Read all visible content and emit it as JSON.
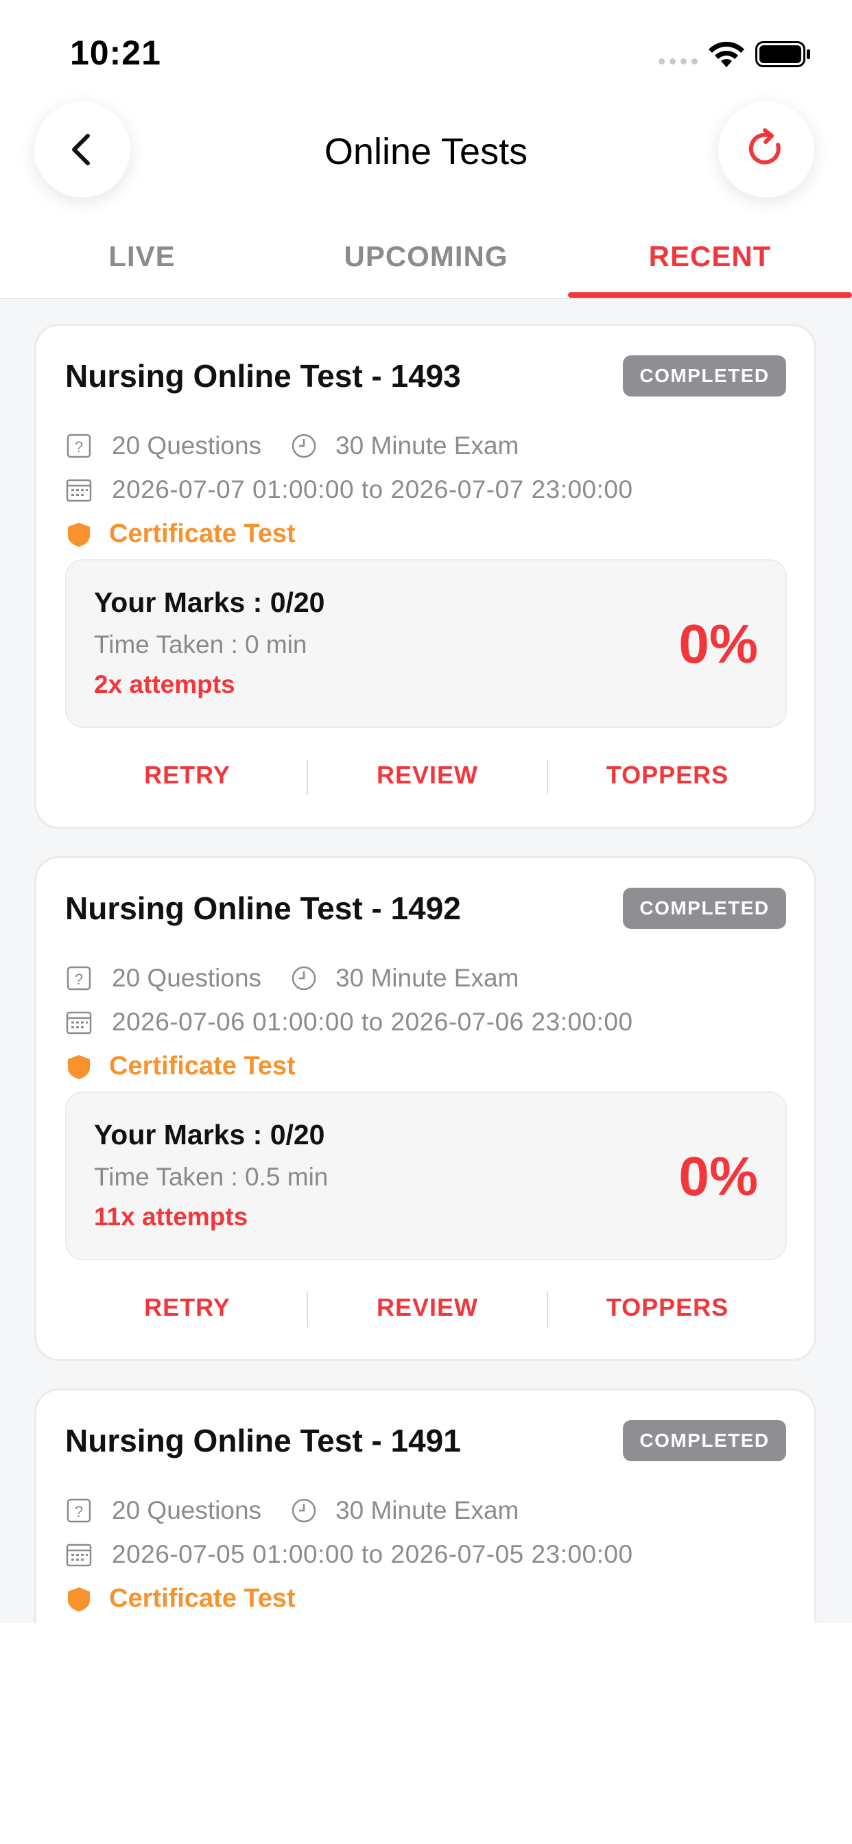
{
  "status_bar": {
    "time": "10:21"
  },
  "header": {
    "title": "Online Tests"
  },
  "tabs": [
    {
      "label": "LIVE"
    },
    {
      "label": "UPCOMING"
    },
    {
      "label": "RECENT"
    }
  ],
  "colors": {
    "accent": "#f2363b",
    "certificate": "#f7922d",
    "badge": "#8e8e93"
  },
  "tests": [
    {
      "title": "Nursing Online Test - 1493",
      "status": "COMPLETED",
      "questions": "20 Questions",
      "duration": "30 Minute Exam",
      "date_range": "2026-07-07 01:00:00 to 2026-07-07 23:00:00",
      "certificate": "Certificate Test",
      "marks": "Your Marks : 0/20",
      "time_taken": "Time Taken : 0 min",
      "attempts": "2x attempts",
      "percent": "0%",
      "actions": [
        "RETRY",
        "REVIEW",
        "TOPPERS"
      ]
    },
    {
      "title": "Nursing Online Test - 1492",
      "status": "COMPLETED",
      "questions": "20 Questions",
      "duration": "30 Minute Exam",
      "date_range": "2026-07-06 01:00:00 to 2026-07-06 23:00:00",
      "certificate": "Certificate Test",
      "marks": "Your Marks : 0/20",
      "time_taken": "Time Taken : 0.5 min",
      "attempts": "11x attempts",
      "percent": "0%",
      "actions": [
        "RETRY",
        "REVIEW",
        "TOPPERS"
      ]
    },
    {
      "title": "Nursing Online Test - 1491",
      "status": "COMPLETED",
      "questions": "20 Questions",
      "duration": "30 Minute Exam",
      "date_range": "2026-07-05 01:00:00 to 2026-07-05 23:00:00",
      "certificate": "Certificate Test",
      "marks": "",
      "time_taken": "",
      "attempts": "",
      "percent": "",
      "actions": [
        "",
        "",
        ""
      ]
    }
  ]
}
